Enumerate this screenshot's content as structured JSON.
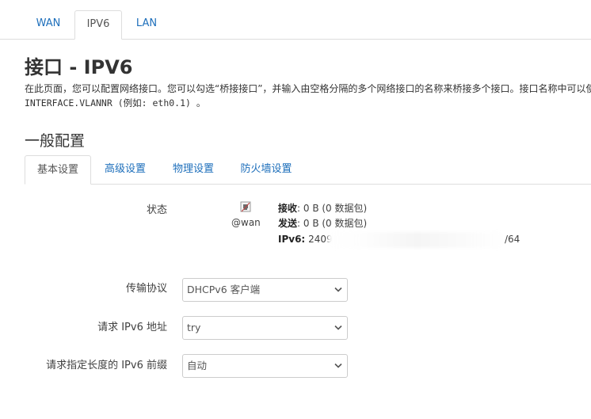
{
  "top_tabs": [
    {
      "label": "WAN",
      "active": false
    },
    {
      "label": "IPV6",
      "active": true
    },
    {
      "label": "LAN",
      "active": false
    }
  ],
  "page": {
    "title": "接口 - IPV6",
    "description": "在此页面，您可以配置网络接口。您可以勾选“桥接接口”，并输入由空格分隔的多个网络接口的名称来桥接多个接口。接口名称中可以使用",
    "description_mono": "INTERFACE.VLANNR (例如: eth0.1) 。"
  },
  "section": {
    "title": "一般配置"
  },
  "sub_tabs": [
    {
      "label": "基本设置",
      "active": true
    },
    {
      "label": "高级设置",
      "active": false
    },
    {
      "label": "物理设置",
      "active": false
    },
    {
      "label": "防火墙设置",
      "active": false
    }
  ],
  "status": {
    "label": "状态",
    "interface_icon": "network-port-icon",
    "interface_name": "@wan",
    "rx_label": "接收",
    "rx_value": ": 0 B (0 数据包)",
    "tx_label": "发送",
    "tx_value": ": 0 B (0 数据包)",
    "ipv6_label": "IPv6:",
    "ipv6_prefix": "2409",
    "ipv6_suffix": "/64"
  },
  "fields": {
    "protocol": {
      "label": "传输协议",
      "value": "DHCPv6 客户端"
    },
    "request_ipv6": {
      "label": "请求 IPv6 地址",
      "value": "try"
    },
    "prefix_length": {
      "label": "请求指定长度的 IPv6 前缀",
      "value": "自动"
    }
  },
  "colors": {
    "link": "#1e6fbb",
    "border": "#dddddd",
    "text": "#404040"
  }
}
